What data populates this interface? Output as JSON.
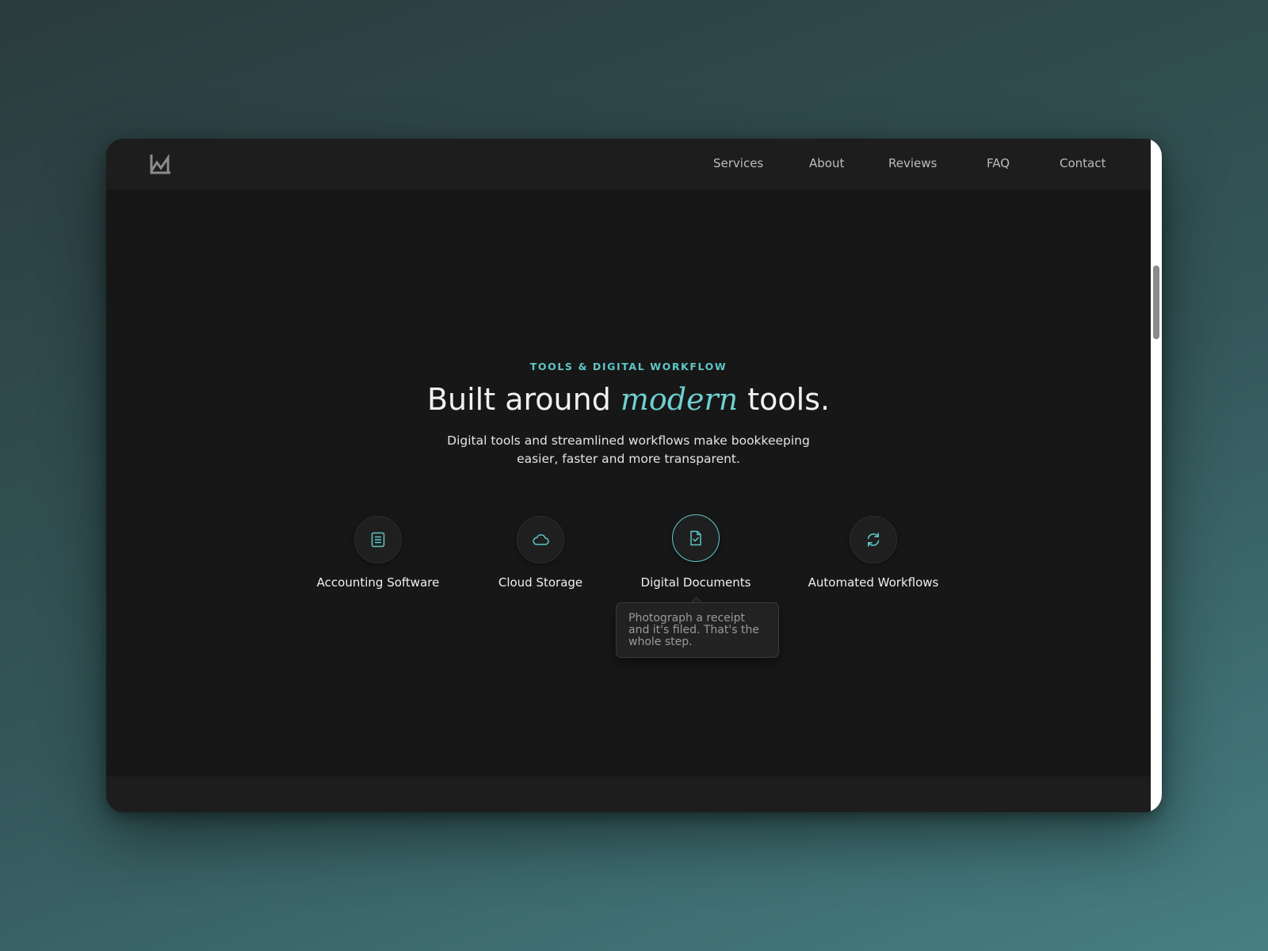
{
  "nav": {
    "links": [
      "Services",
      "About",
      "Reviews",
      "FAQ",
      "Contact"
    ]
  },
  "hero": {
    "eyebrow": "TOOLS & DIGITAL WORKFLOW",
    "title_before": "Built around",
    "title_accent": "modern",
    "title_after": "tools.",
    "subtitle": "Digital tools and streamlined workflows make bookkeeping easier, faster and more transparent."
  },
  "features": [
    {
      "label": "Accounting Software",
      "icon": "document-lines-icon"
    },
    {
      "label": "Cloud Storage",
      "icon": "cloud-icon"
    },
    {
      "label": "Digital Documents",
      "icon": "document-check-icon",
      "active": true
    },
    {
      "label": "Automated Workflows",
      "icon": "refresh-icon"
    }
  ],
  "tooltip": {
    "text": "Photograph a receipt and it's filed. That's the whole step."
  },
  "colors": {
    "accent": "#5fc6c6",
    "background": "#171717",
    "navbar": "#1d1d1d"
  }
}
